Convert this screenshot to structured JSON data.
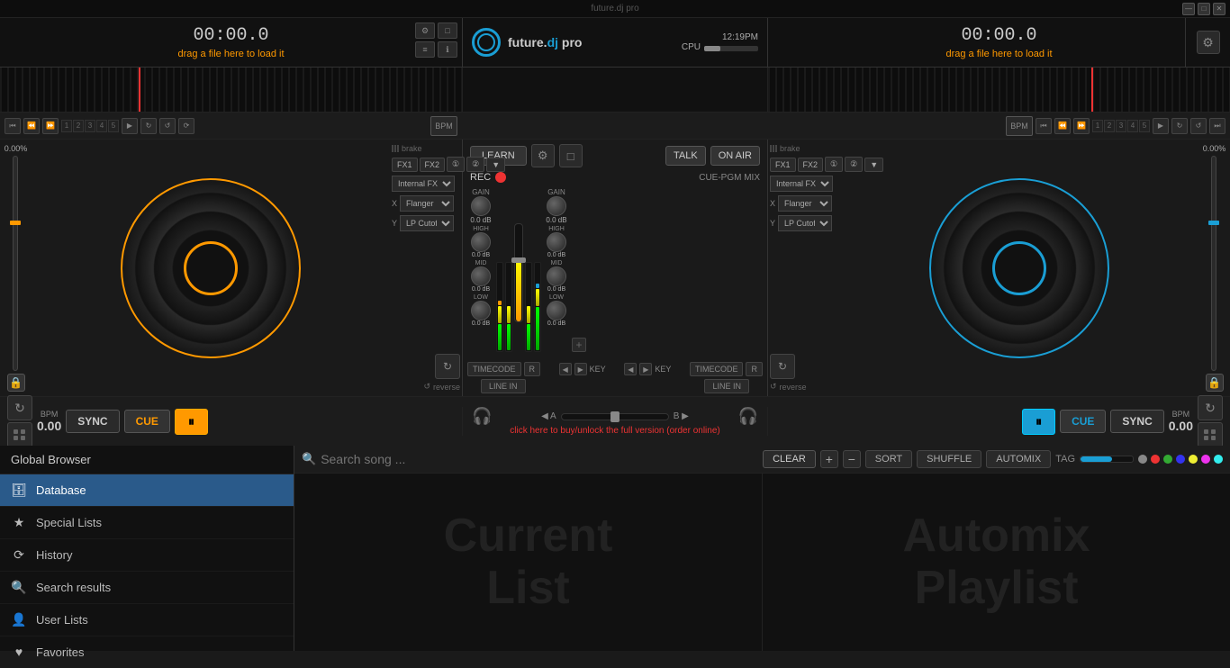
{
  "app": {
    "title": "future.dj pro",
    "time": "12:19PM",
    "cpu_label": "CPU"
  },
  "deck_a": {
    "label": "A",
    "time": "00:00.0",
    "drag_hint": "drag a file here to load it",
    "bpm_label": "BPM",
    "bpm_value": "0.00",
    "percent": "0.00%",
    "sync": "SYNC",
    "cue": "CUE",
    "brake": "brake",
    "reverse": "reverse",
    "fx1": "FX1",
    "fx2": "FX2",
    "internal_fx": "Internal FX",
    "flanger": "Flanger",
    "lp_cutoff": "LP Cutoff"
  },
  "deck_b": {
    "label": "B",
    "time": "00:00.0",
    "drag_hint": "drag a file here to load it",
    "bpm_label": "BPM",
    "bpm_value": "0.00",
    "percent": "0.00%",
    "sync": "SYNC",
    "cue": "CUE",
    "brake": "brake",
    "reverse": "reverse",
    "fx1": "FX1",
    "fx2": "FX2",
    "internal_fx": "Internal FX",
    "flanger": "Flanger",
    "lp_cutoff": "LP Cutoff"
  },
  "mixer": {
    "learn": "LEARN",
    "rec": "REC",
    "talk": "TALK",
    "on_air": "ON AIR",
    "cue_pgm": "CUE-PGM MIX",
    "gain_label_a": "GAIN",
    "gain_val_a": "0.0 dB",
    "high_label": "HIGH",
    "high_val": "0.0 dB",
    "mid_label": "MID",
    "mid_val": "0.0 dB",
    "low_label": "LOW",
    "low_val": "0.0 dB",
    "timecode": "TIMECODE",
    "key": "KEY",
    "line_in": "LINE IN",
    "r_btn": "R"
  },
  "transport_a": {
    "cue_points": [
      "1",
      "2",
      "3",
      "4",
      "5"
    ],
    "bpm": "BPM"
  },
  "transport_b": {
    "cue_points": [
      "1",
      "2",
      "3",
      "4",
      "5"
    ],
    "bpm": "BPM"
  },
  "bottom_bar": {
    "headphone_left": "🎧",
    "label_a": "◀ A",
    "label_b": "B ▶",
    "headphone_right": "🎧",
    "upgrade_notice": "click here to buy/unlock the full version (order online)"
  },
  "bottom_panel": {
    "global_browser": "Global Browser",
    "search_placeholder": "Search song ...",
    "clear": "CLEAR",
    "sort": "SORT",
    "shuffle": "SHUFFLE",
    "automix": "AUTOMIX",
    "tag": "TAG",
    "current_list": "Current\nList",
    "automix_playlist": "Automix\nPlaylist",
    "sidebar": {
      "items": [
        {
          "label": "Database",
          "icon": "🗄",
          "active": true
        },
        {
          "label": "Special Lists",
          "icon": "★"
        },
        {
          "label": "History",
          "icon": "⟳"
        },
        {
          "label": "Search results",
          "icon": "🔍"
        },
        {
          "label": "User Lists",
          "icon": "👤"
        },
        {
          "label": "Favorites",
          "icon": "♥"
        }
      ]
    }
  },
  "window_controls": {
    "minimize": "—",
    "maximize": "□",
    "close": "✕"
  },
  "colors": {
    "accent_a": "#f90",
    "accent_b": "#1a9ed4",
    "dot1": "#ff4444",
    "dot2": "#44ff44",
    "dot3": "#4444ff",
    "dot4": "#ffff44",
    "dot5": "#ff44ff",
    "dot6": "#44ffff"
  }
}
